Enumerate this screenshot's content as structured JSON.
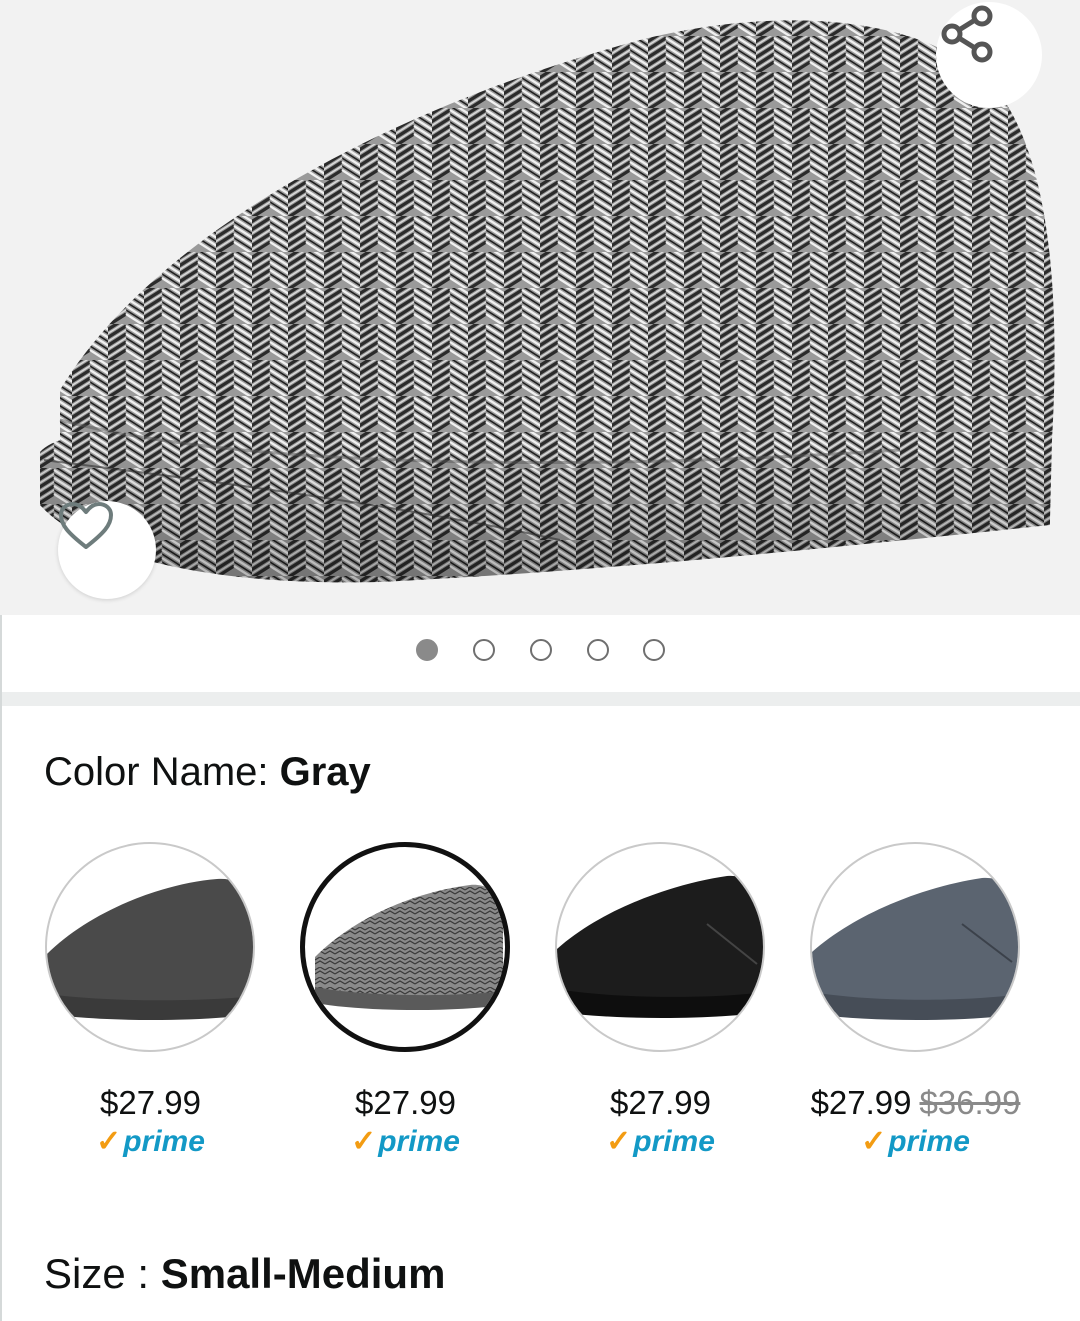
{
  "color": {
    "label": "Color Name: ",
    "value": "Gray"
  },
  "carousel": {
    "dot_count": 5,
    "active_index": 0
  },
  "swatches": [
    {
      "price": "$27.99",
      "list_price": "",
      "prime": "prime",
      "tone": "#4a4a4a"
    },
    {
      "price": "$27.99",
      "list_price": "",
      "prime": "prime",
      "tone": "#7a7a7a"
    },
    {
      "price": "$27.99",
      "list_price": "",
      "prime": "prime",
      "tone": "#1c1c1c"
    },
    {
      "price": "$27.99",
      "list_price": "$36.99",
      "prime": "prime",
      "tone": "#5b6470"
    }
  ],
  "size": {
    "label": "Size : ",
    "value": "Small-Medium"
  },
  "icons": {
    "share": "share-icon",
    "wishlist": "heart-outline-icon",
    "prime_check": "check-icon"
  },
  "colors": {
    "prime_blue": "#1399c6",
    "prime_check": "#f39c12",
    "hero_bg": "#f2f2f2"
  }
}
